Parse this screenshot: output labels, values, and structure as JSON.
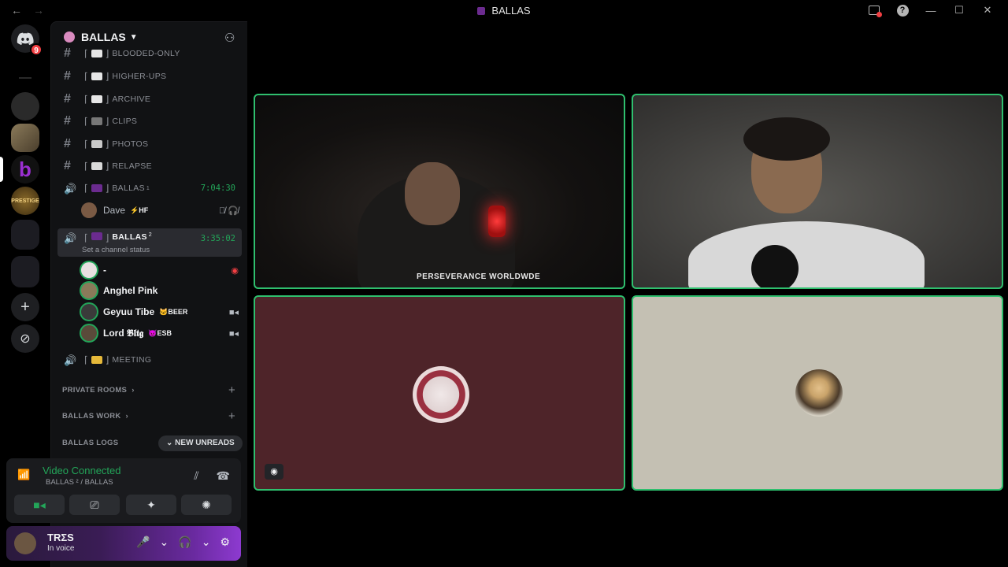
{
  "titlebar": {
    "back": "←",
    "forward": "→",
    "title": "BALLAS"
  },
  "guilds": {
    "discord_badge": "9"
  },
  "server": {
    "name": "BALLAS"
  },
  "channels": [
    {
      "label": "BLOODED-ONLY"
    },
    {
      "label": "HIGHER-UPS"
    },
    {
      "label": "ARCHIVE"
    },
    {
      "label": "CLIPS"
    },
    {
      "label": "PHOTOS"
    },
    {
      "label": "RELAPSE"
    }
  ],
  "voice1": {
    "label": "BALLAS",
    "sup": "1",
    "time": "7:04:30",
    "user": "Dave",
    "user_tag": "⚡HF"
  },
  "voice2": {
    "label": "BALLAS",
    "sup": "2",
    "time": "3:35:02",
    "status": "Set a channel status"
  },
  "voice2_users": [
    {
      "name": "-"
    },
    {
      "name": "Anghel Pink",
      "tag": ""
    },
    {
      "name": "Geyuu Tibe",
      "tag": "🐱BEER"
    },
    {
      "name": "Lord 𝕭𝖑𝖙𝖌",
      "tag": "😈ESB"
    }
  ],
  "meeting": {
    "label": "MEETING"
  },
  "categories": {
    "private": "PRIVATE ROOMS",
    "work": "BALLAS WORK",
    "logs": "BALLAS LOGS"
  },
  "new_unreads": "NEW UNREADS",
  "voice_panel": {
    "title": "Video Connected",
    "sub": "BALLAS ² / BALLAS"
  },
  "user": {
    "name": "TRΣS",
    "status": "In voice"
  },
  "video": {
    "shirt": "PERSEVERANCE WORLDWDE"
  },
  "colors": {
    "accent": "#23a559",
    "border": "#2fbf6e"
  }
}
